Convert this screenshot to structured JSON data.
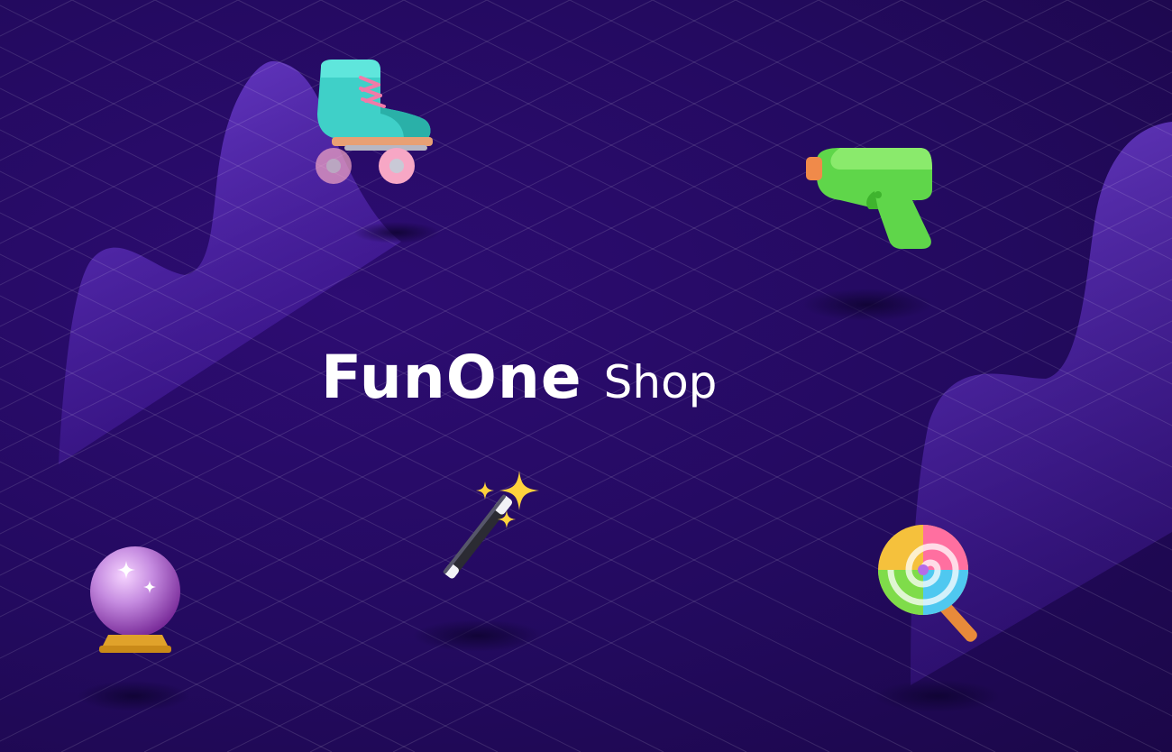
{
  "brand": {
    "name": "FunOne",
    "suffix": "Shop",
    "text_color": "#ffffff"
  },
  "colors": {
    "background": "#230a5a",
    "wave": "#6a3ad0",
    "grid_line": "#ffffff"
  },
  "items": [
    {
      "id": "roller-skate-icon",
      "color": "#3fd0c8"
    },
    {
      "id": "water-pistol-icon",
      "color": "#5fd64a"
    },
    {
      "id": "magic-wand-icon",
      "color": "#2a2a2a"
    },
    {
      "id": "crystal-ball-icon",
      "color": "#c58be0"
    },
    {
      "id": "lollipop-icon",
      "color": "#f0a040"
    }
  ]
}
